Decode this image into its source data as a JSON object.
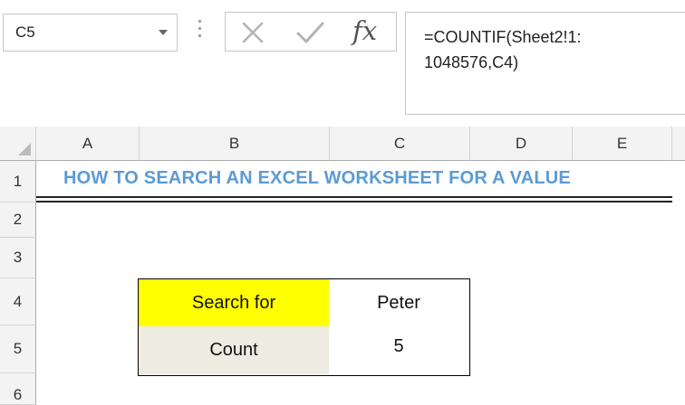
{
  "formula_bar": {
    "name_box": "C5",
    "fx_label": "fx",
    "formula": "=COUNTIF(Sheet2!1:\n1048576,C4)"
  },
  "sheet": {
    "columns": [
      "A",
      "B",
      "C",
      "D",
      "E"
    ],
    "rows": [
      "1",
      "2",
      "3",
      "4",
      "5",
      "6"
    ],
    "title": "HOW TO SEARCH AN EXCEL WORKSHEET FOR A VALUE",
    "table": {
      "search_label": "Search for",
      "search_value": "Peter",
      "count_label": "Count",
      "count_value": "5"
    }
  },
  "colors": {
    "title": "#5b9bd5",
    "search_fill": "#ffff00",
    "count_fill": "#eeece1"
  }
}
